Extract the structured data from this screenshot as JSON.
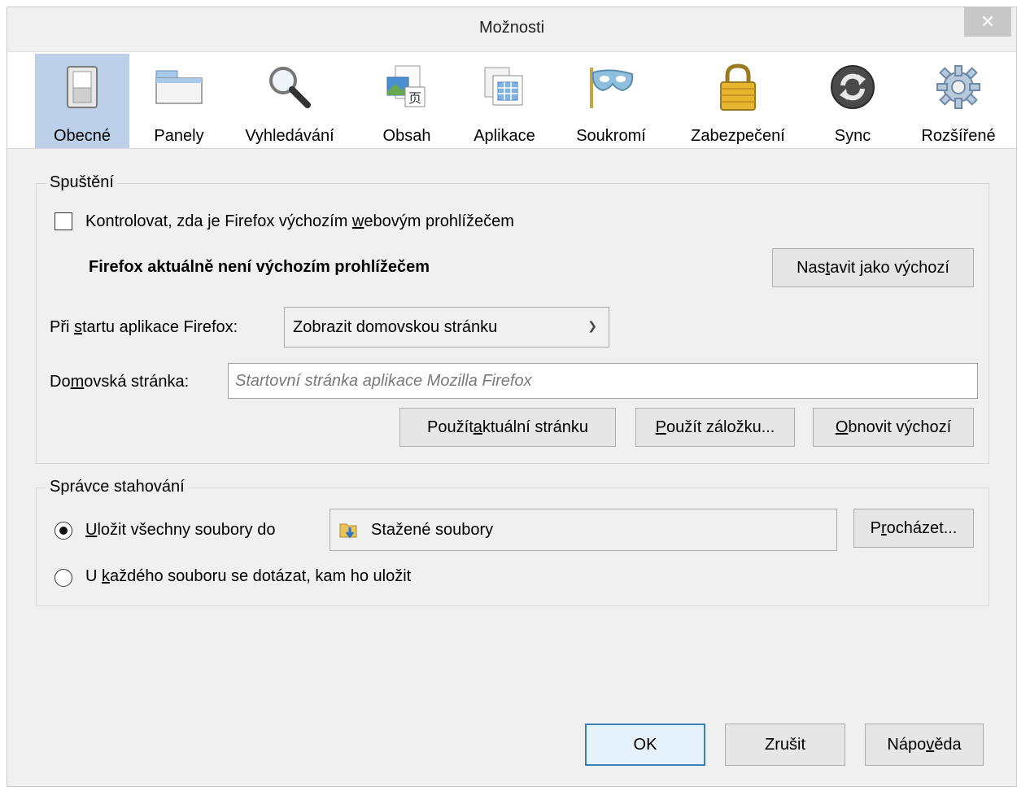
{
  "window": {
    "title": "Možnosti",
    "close_glyph": "✕"
  },
  "toolbar": {
    "active_color": "#bcd0ea",
    "items": [
      {
        "label": "Obecné",
        "icon": "switch-icon"
      },
      {
        "label": "Panely",
        "icon": "tabs-window-icon"
      },
      {
        "label": "Vyhledávání",
        "icon": "magnifier-icon"
      },
      {
        "label": "Obsah",
        "icon": "content-page-icon"
      },
      {
        "label": "Aplikace",
        "icon": "applications-icon"
      },
      {
        "label": "Soukromí",
        "icon": "mask-icon"
      },
      {
        "label": "Zabezpečení",
        "icon": "padlock-icon"
      },
      {
        "label": "Sync",
        "icon": "sync-icon"
      },
      {
        "label": "Rozšířené",
        "icon": "gear-icon"
      }
    ]
  },
  "startup": {
    "legend": "Spuštění",
    "check_default": {
      "pre": "Kontrolovat, zda je Firefox výchozím ",
      "accel": "w",
      "post": "ebovým prohlížečem",
      "checked": false
    },
    "not_default_text": "Firefox aktuálně není výchozím prohlížečem",
    "set_default_button": {
      "pre": "Nas",
      "accel": "t",
      "post": "avit jako výchozí"
    },
    "on_start_label": {
      "pre": "Při ",
      "accel": "s",
      "post": "tartu aplikace Firefox:"
    },
    "on_start_value": "Zobrazit domovskou stránku",
    "homepage_label": {
      "pre": "Do",
      "accel": "m",
      "post": "ovská stránka:"
    },
    "homepage_placeholder": "Startovní stránka aplikace Mozilla Firefox",
    "use_current_button": {
      "pre": "Použít ",
      "accel": "a",
      "post": "ktuální stránku"
    },
    "use_bookmark_button": {
      "pre": "",
      "accel": "P",
      "post": "oužít záložku..."
    },
    "restore_default_button": {
      "pre": "",
      "accel": "O",
      "post": "bnovit výchozí"
    }
  },
  "downloads": {
    "legend": "Správce stahování",
    "save_to": {
      "pre": "",
      "accel": "U",
      "post": "ložit všechny soubory do",
      "selected": true
    },
    "folder_name": "Stažené soubory",
    "browse_button": {
      "pre": "P",
      "accel": "r",
      "post": "ocházet..."
    },
    "ask_each": {
      "pre": "U ",
      "accel": "k",
      "post": "aždého souboru se dotázat, kam ho uložit",
      "selected": false
    }
  },
  "footer": {
    "ok_label": "OK",
    "cancel_label": "Zrušit",
    "help_label": {
      "pre": "Nápo",
      "accel": "v",
      "post": "ěda"
    }
  }
}
